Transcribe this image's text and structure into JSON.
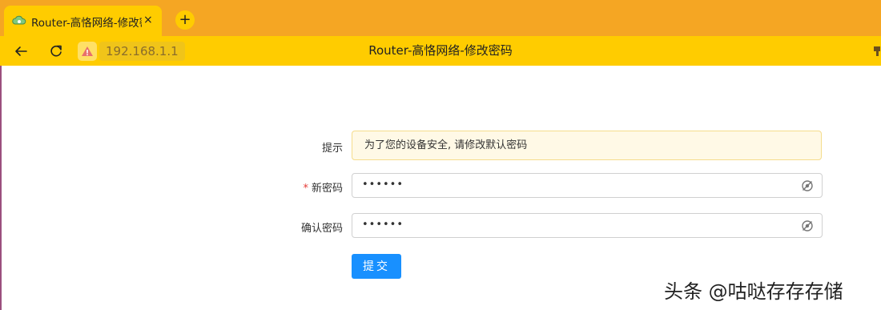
{
  "browser": {
    "tab_title": "Router-高恪网络-修改密",
    "tab_close": "×",
    "new_tab": "+",
    "address": "192.168.1.1",
    "page_title": "Router-高恪网络-修改密码"
  },
  "form": {
    "notice_label": "提示",
    "notice_text": "为了您的设备安全, 请修改默认密码",
    "required_mark": "*",
    "new_password_label": "新密码",
    "new_password_value": "••••••",
    "confirm_password_label": "确认密码",
    "confirm_password_value": "••••••",
    "submit_label": "提交"
  },
  "watermark": "头条 @咕哒存存存储",
  "colors": {
    "tabstrip": "#f5a623",
    "toolbar": "#ffcc00",
    "primary": "#1890ff",
    "notice_bg": "#fff9e6"
  }
}
